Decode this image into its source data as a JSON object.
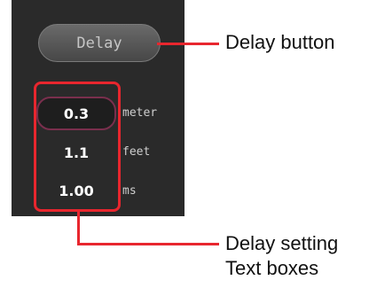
{
  "panel": {
    "delay_button_label": "Delay",
    "rows": [
      {
        "value": "0.3",
        "unit": "meter"
      },
      {
        "value": "1.1",
        "unit": "feet"
      },
      {
        "value": "1.00",
        "unit": "ms"
      }
    ]
  },
  "callouts": {
    "delay_button": "Delay button",
    "delay_setting_line1": "Delay setting",
    "delay_setting_line2": "Text boxes"
  },
  "colors": {
    "callout_red": "#e8262e",
    "panel_bg": "#2a2a2a",
    "active_border": "#7a2f4d"
  }
}
